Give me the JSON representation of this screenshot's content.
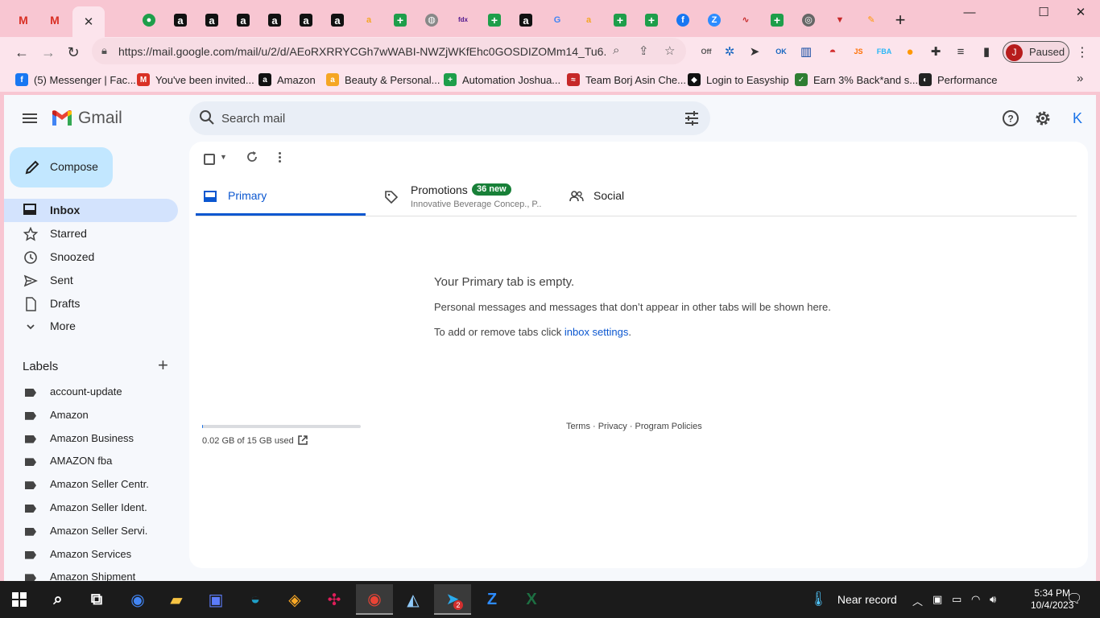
{
  "browser": {
    "active_tab_close": "✕",
    "tab_favicons": [
      {
        "name": "gmail-tab-icon",
        "kind": "gm",
        "glyph": "M"
      },
      {
        "name": "gmail-tab-icon",
        "kind": "gm",
        "glyph": "M"
      },
      {
        "name": "generic-tab-icon",
        "kind": "circle",
        "glyph": "●",
        "color": "#1e9e4a"
      },
      {
        "name": "amazon-tab-icon",
        "kind": "amz",
        "glyph": "a"
      },
      {
        "name": "amazon-tab-icon",
        "kind": "amz",
        "glyph": "a"
      },
      {
        "name": "amazon-tab-icon",
        "kind": "amz",
        "glyph": "a"
      },
      {
        "name": "amazon-tab-icon",
        "kind": "amz",
        "glyph": "a"
      },
      {
        "name": "amazon-tab-icon",
        "kind": "amz",
        "glyph": "a"
      },
      {
        "name": "amazon-tab-icon",
        "kind": "amz",
        "glyph": "a"
      },
      {
        "name": "amazon-smile-tab-icon",
        "kind": "plain",
        "glyph": "a",
        "color": "#f5a623"
      },
      {
        "name": "sheets-tab-icon",
        "kind": "sheet",
        "glyph": "+"
      },
      {
        "name": "globe-tab-icon",
        "kind": "circle",
        "glyph": "◍",
        "color": "#888"
      },
      {
        "name": "fedex-tab-icon",
        "kind": "plain",
        "glyph": "fdx",
        "color": "#4d148c"
      },
      {
        "name": "sheets-tab-icon",
        "kind": "sheet",
        "glyph": "+"
      },
      {
        "name": "amazon-tab-icon",
        "kind": "amz",
        "glyph": "a"
      },
      {
        "name": "google-tab-icon",
        "kind": "plain",
        "glyph": "G",
        "color": "#4285f4"
      },
      {
        "name": "amazon-smile-tab-icon",
        "kind": "plain",
        "glyph": "a",
        "color": "#f5a623"
      },
      {
        "name": "sheets-tab-icon",
        "kind": "sheet",
        "glyph": "+"
      },
      {
        "name": "sheets-tab-icon",
        "kind": "sheet",
        "glyph": "+"
      },
      {
        "name": "facebook-tab-icon",
        "kind": "circle",
        "glyph": "f",
        "color": "#1877f2"
      },
      {
        "name": "zoom-tab-icon",
        "kind": "circle",
        "glyph": "Z",
        "color": "#2d8cff"
      },
      {
        "name": "chart-tab-icon",
        "kind": "plain",
        "glyph": "∿",
        "color": "#c62828"
      },
      {
        "name": "sheets-tab-icon",
        "kind": "sheet",
        "glyph": "+"
      },
      {
        "name": "chrome-tab-icon",
        "kind": "circle",
        "glyph": "◎",
        "color": "#666"
      },
      {
        "name": "vivaldi-tab-icon",
        "kind": "plain",
        "glyph": "▼",
        "color": "#c62828"
      },
      {
        "name": "pencil-tab-icon",
        "kind": "plain",
        "glyph": "✎",
        "color": "#ff9800"
      }
    ],
    "new_tab": "+",
    "window_controls": {
      "minimize": "—",
      "maximize": "☐",
      "close": "✕"
    },
    "url": "https://mail.google.com/mail/u/2/d/AEoRXRRYCGh7wWABI-NWZjWKfEhc0GOSDIZOMm14_Tu6...",
    "profile": {
      "initial": "J",
      "status": "Paused"
    },
    "extensions": [
      {
        "name": "extension-off-icon",
        "glyph": "Off",
        "color": "#555"
      },
      {
        "name": "extension-steering-icon",
        "glyph": "✲",
        "color": "#1565c0"
      },
      {
        "name": "extension-arrow-icon",
        "glyph": "➤",
        "color": "#333"
      },
      {
        "name": "extension-ok-icon",
        "glyph": "OK",
        "color": "#1565c0"
      },
      {
        "name": "extension-chart-icon",
        "glyph": "▥",
        "color": "#0d47a1"
      },
      {
        "name": "extension-pokeball-icon",
        "glyph": "◓",
        "color": "#d32f2f"
      },
      {
        "name": "extension-js-icon",
        "glyph": "JS",
        "color": "#ff6f00"
      },
      {
        "name": "extension-fba-icon",
        "glyph": "FBA",
        "color": "#29b6f6"
      },
      {
        "name": "extension-orange-icon",
        "glyph": "●",
        "color": "#ff9800"
      },
      {
        "name": "extensions-puzzle-icon",
        "glyph": "✚",
        "color": "#333"
      },
      {
        "name": "media-controls-icon",
        "glyph": "≡",
        "color": "#333"
      },
      {
        "name": "side-panel-icon",
        "glyph": "▮",
        "color": "#333"
      }
    ],
    "bookmarks": [
      {
        "label": "(5) Messenger | Fac...",
        "icon": "facebook-icon",
        "glyph": "f",
        "color": "#1877f2"
      },
      {
        "label": "You've been invited...",
        "icon": "gmail-icon",
        "glyph": "M",
        "color": "#d93025"
      },
      {
        "label": "Amazon",
        "icon": "amazon-icon",
        "glyph": "a",
        "color": "#111"
      },
      {
        "label": "Beauty & Personal...",
        "icon": "amazon-smile-icon",
        "glyph": "a",
        "color": "#f5a623"
      },
      {
        "label": "Automation Joshua...",
        "icon": "sheets-icon",
        "glyph": "+",
        "color": "#1e9e4a"
      },
      {
        "label": "Team Borj Asin Che...",
        "icon": "team-icon",
        "glyph": "≈",
        "color": "#c62828"
      },
      {
        "label": "Login to Easyship",
        "icon": "easyship-icon",
        "glyph": "◆",
        "color": "#111"
      },
      {
        "label": "Earn 3% Back*and s...",
        "icon": "earn-icon",
        "glyph": "✓",
        "color": "#2e7d32"
      },
      {
        "label": "Performance",
        "icon": "performance-icon",
        "glyph": "◐",
        "color": "#222"
      }
    ],
    "bookmarks_overflow": "»"
  },
  "gmail": {
    "logo_text": "Gmail",
    "search_placeholder": "Search mail",
    "account_initial": "K",
    "compose_label": "Compose",
    "nav": [
      {
        "name": "inbox",
        "label": "Inbox",
        "icon": "inbox-icon",
        "active": true
      },
      {
        "name": "starred",
        "label": "Starred",
        "icon": "star-icon"
      },
      {
        "name": "snoozed",
        "label": "Snoozed",
        "icon": "clock-icon"
      },
      {
        "name": "sent",
        "label": "Sent",
        "icon": "send-icon"
      },
      {
        "name": "drafts",
        "label": "Drafts",
        "icon": "draft-icon"
      },
      {
        "name": "more",
        "label": "More",
        "icon": "chevron-down-icon"
      }
    ],
    "labels_title": "Labels",
    "labels": [
      "account-update",
      "Amazon",
      "Amazon Business",
      "AMAZON fba",
      "Amazon Seller Centr.",
      "Amazon Seller Ident.",
      "Amazon Seller Servi.",
      "Amazon Services",
      "Amazon Shipment"
    ],
    "tabs": {
      "primary": "Primary",
      "promotions": "Promotions",
      "promotions_badge": "36 new",
      "promotions_snippet": "Innovative Beverage Concep., P...",
      "social": "Social"
    },
    "empty": {
      "title": "Your Primary tab is empty.",
      "description": "Personal messages and messages that don’t appear in other tabs will be shown here.",
      "settings_prefix": "To add or remove tabs click ",
      "settings_link": "inbox settings",
      "settings_suffix": "."
    },
    "storage": {
      "text": "0.02 GB of 15 GB used",
      "used_fraction": 0.0013
    },
    "footer": "Terms · Privacy · Program Policies"
  },
  "taskbar": {
    "apps": [
      {
        "name": "search-taskbar-icon",
        "color": "#fff",
        "glyph": "⌕"
      },
      {
        "name": "task-view-icon",
        "color": "#fff",
        "glyph": "⧉"
      },
      {
        "name": "chrome-taskbar-icon",
        "color": "#4285f4",
        "glyph": "◉"
      },
      {
        "name": "file-explorer-icon",
        "color": "#f6c343",
        "glyph": "▰"
      },
      {
        "name": "remote-desktop-icon",
        "color": "#5c7cfa",
        "glyph": "▣"
      },
      {
        "name": "edge-icon",
        "color": "#1fa0c8",
        "glyph": "◒"
      },
      {
        "name": "vpn-icon",
        "color": "#f9a825",
        "glyph": "◈"
      },
      {
        "name": "slack-icon",
        "color": "#e01e5a",
        "glyph": "✣"
      },
      {
        "name": "chrome-profile-taskbar-icon",
        "color": "#ea4335",
        "glyph": "◉",
        "active": true
      },
      {
        "name": "app-taskbar-icon",
        "color": "#90caf9",
        "glyph": "◭"
      },
      {
        "name": "telegram-icon",
        "color": "#2aabee",
        "glyph": "➤",
        "active": true,
        "badge": "2"
      },
      {
        "name": "zoom-taskbar-icon",
        "color": "#2d8cff",
        "glyph": "Z"
      },
      {
        "name": "excel-icon",
        "color": "#1d6f42",
        "glyph": "X"
      }
    ],
    "weather": "Near record",
    "time": "5:34 PM",
    "date": "10/4/2023"
  }
}
